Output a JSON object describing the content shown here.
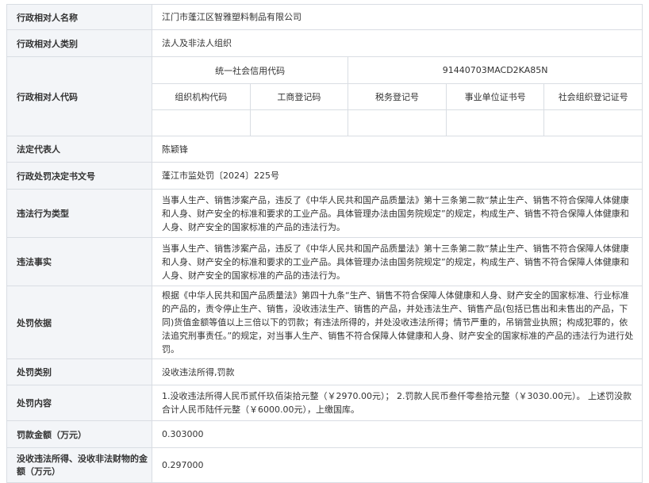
{
  "rows": {
    "name": {
      "label": "行政相对人名称",
      "value": "江门市蓬江区智雅塑料制品有限公司"
    },
    "type": {
      "label": "行政相对人类别",
      "value": "法人及非法人组织"
    },
    "code": {
      "label": "行政相对人代码",
      "credit_code_label": "统一社会信用代码",
      "credit_code_value": "91440703MACD2KA85N",
      "sub_headers": [
        "组织机构代码",
        "工商登记码",
        "税务登记号",
        "事业单位证书号",
        "社会组织登记证号"
      ],
      "sub_values": [
        "",
        "",
        "",
        "",
        ""
      ]
    },
    "legal_rep": {
      "label": "法定代表人",
      "value": "陈颖锋"
    },
    "decision_no": {
      "label": "行政处罚决定书文号",
      "value": "蓬江市监处罚〔2024〕225号"
    },
    "violation_type": {
      "label": "违法行为类型",
      "value": "当事人生产、销售涉案产品，违反了《中华人民共和国产品质量法》第十三条第二款“禁止生产、销售不符合保障人体健康和人身、财产安全的标准和要求的工业产品。具体管理办法由国务院规定”的规定，构成生产、销售不符合保障人体健康和人身、财产安全的国家标准的产品的违法行为。"
    },
    "facts": {
      "label": "违法事实",
      "value": "当事人生产、销售涉案产品，违反了《中华人民共和国产品质量法》第十三条第二款“禁止生产、销售不符合保障人体健康和人身、财产安全的标准和要求的工业产品。具体管理办法由国务院规定”的规定，构成生产、销售不符合保障人体健康和人身、财产安全的国家标准的产品的违法行为。"
    },
    "basis": {
      "label": "处罚依据",
      "value": "根据《中华人民共和国产品质量法》第四十九条“生产、销售不符合保障人体健康和人身、财产安全的国家标准、行业标准的产品的，责令停止生产、销售，没收违法生产、销售的产品，并处违法生产、销售产品(包括已售出和未售出的产品，下同)货值金额等值以上三倍以下的罚款；有违法所得的，并处没收违法所得；情节严重的，吊销营业执照；构成犯罪的，依法追究刑事责任。”的规定，对当事人生产、销售不符合保障人体健康和人身、财产安全的国家标准的产品的违法行为进行处罚。"
    },
    "category": {
      "label": "处罚类别",
      "value": "没收违法所得,罚款"
    },
    "content": {
      "label": "处罚内容",
      "value": "1.没收违法所得人民币贰仟玖佰柒拾元整（￥2970.00元）；  2.罚款人民币叁仟零叁拾元整（￥3030.00元）。 上述罚没款合计人民币陆仟元整（￥6000.00元），上缴国库。"
    },
    "fine": {
      "label": "罚款金额（万元）",
      "value": "0.303000"
    },
    "confiscated": {
      "label": "没收违法所得、没收非法财物的金额（万元）",
      "value": "0.297000"
    }
  }
}
